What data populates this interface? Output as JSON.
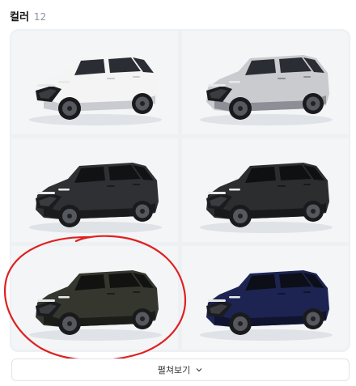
{
  "section": {
    "title": "컬러",
    "count": "12"
  },
  "colors": [
    {
      "body": "#f4f4f4",
      "shade": "#c9cbd0",
      "window": "#2a2d33"
    },
    {
      "body": "#c9cbcf",
      "shade": "#8c8f95",
      "window": "#2a2d33"
    },
    {
      "body": "#2f3033",
      "shade": "#1a1b1d",
      "window": "#111214"
    },
    {
      "body": "#2c2d2f",
      "shade": "#18191b",
      "window": "#0f1012"
    },
    {
      "body": "#35372f",
      "shade": "#1c1d18",
      "window": "#121310"
    },
    {
      "body": "#1d2452",
      "shade": "#10142e",
      "window": "#0d0f18"
    }
  ],
  "annotation_color": "#e02020",
  "expand_button": {
    "label": "펼쳐보기"
  }
}
